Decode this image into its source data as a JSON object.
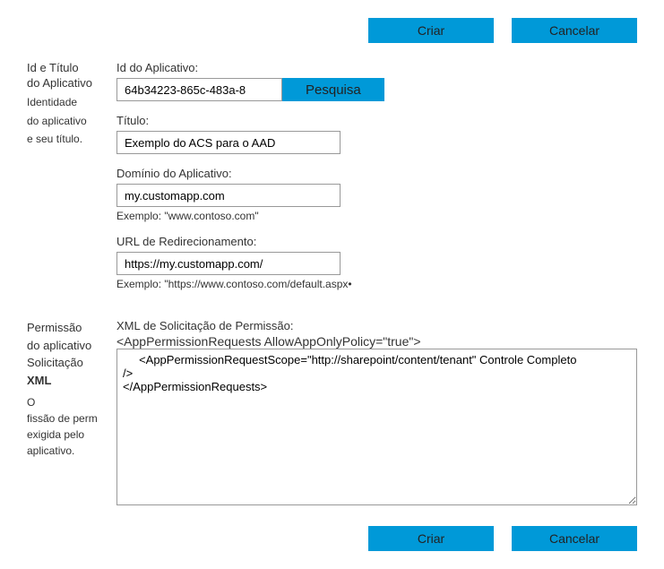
{
  "buttons": {
    "create": "Criar",
    "cancel": "Cancelar",
    "search": "Pesquisa"
  },
  "section1": {
    "side_main1": "Id e Título",
    "side_main2": "do Aplicativo",
    "side_sub1": "Identidade",
    "side_sub2": "do aplicativo",
    "side_sub3": "e seu título.",
    "appid_label": "Id do Aplicativo:",
    "appid_value": "64b34223-865c-483a-8",
    "title_label": "Título:",
    "title_value": "Exemplo do ACS para o AAD",
    "domain_label": "Domínio do Aplicativo:",
    "domain_value": "my.customapp.com",
    "domain_hint": "Exemplo: \"www.contoso.com\"",
    "redirect_label": "URL de Redirecionamento:",
    "redirect_value": "https://my.customapp.com/",
    "redirect_hint": "Exemplo: \"https://www.contoso.com/default.aspx•"
  },
  "section2": {
    "side_l1": "Permissão",
    "side_l2": "do aplicativo",
    "side_l3": "Solicitação",
    "side_l4": "XML",
    "side_l5": "O",
    "side_l6": "fissão de perm",
    "side_l7": "exigida pelo",
    "side_l8": "aplicativo.",
    "xml_label": "XML de Solicitação de Permissão:",
    "xml_pre": "<AppPermissionRequests AllowAppOnlyPolicy=\"true\">",
    "xml_textarea": "     <AppPermissionRequestScope=\"http://sharepoint/content/tenant\" Controle Completo                    />\n</AppPermissionRequests>"
  }
}
